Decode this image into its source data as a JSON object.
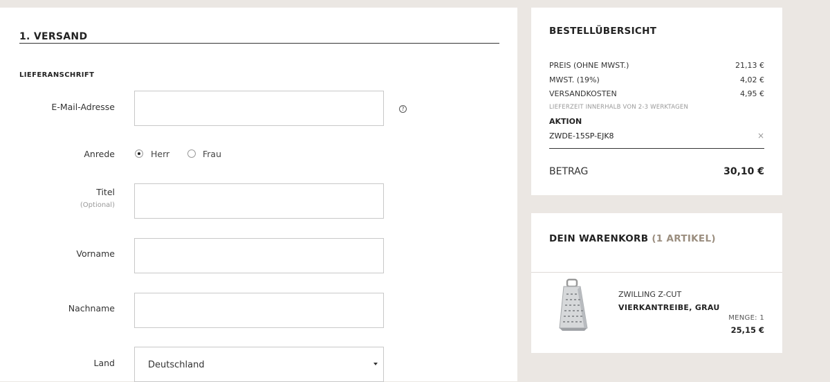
{
  "shipping": {
    "section_title": "1. VERSAND",
    "subheading": "LIEFERANSCHRIFT",
    "email": {
      "label": "E-Mail-Adresse",
      "value": "",
      "help_icon": "question-circle-icon"
    },
    "salutation": {
      "label": "Anrede",
      "options": [
        "Herr",
        "Frau"
      ],
      "selected": "Herr"
    },
    "title": {
      "label": "Titel",
      "note": "(Optional)",
      "value": ""
    },
    "first_name": {
      "label": "Vorname",
      "value": ""
    },
    "last_name": {
      "label": "Nachname",
      "value": ""
    },
    "country": {
      "label": "Land",
      "value": "Deutschland"
    }
  },
  "summary": {
    "title": "BESTELLÜBERSICHT",
    "rows": [
      {
        "label": "PREIS (OHNE MWST.)",
        "value": "21,13 €"
      },
      {
        "label": "MWST. (19%)",
        "value": "4,02 €"
      },
      {
        "label": "VERSANDKOSTEN",
        "value": "4,95 €"
      }
    ],
    "delivery_note": "LIEFERZEIT INNERHALB VON 2-3 WERKTAGEN",
    "promo_heading": "AKTION",
    "promo_code": "ZWDE-15SP-EJK8",
    "total_label": "BETRAG",
    "total_value": "30,10 €"
  },
  "cart": {
    "title": "DEIN WARENKORB",
    "count": "(1 ARTIKEL)",
    "item": {
      "brand": "ZWILLING Z-CUT",
      "name": "VIERKANTREIBE, GRAU",
      "quantity": "MENGE: 1",
      "price": "25,15 €",
      "image_icon": "box-grater-image"
    }
  },
  "colors": {
    "page_bg": "#ebe7e3",
    "accent_count": "#9b8e7f"
  }
}
